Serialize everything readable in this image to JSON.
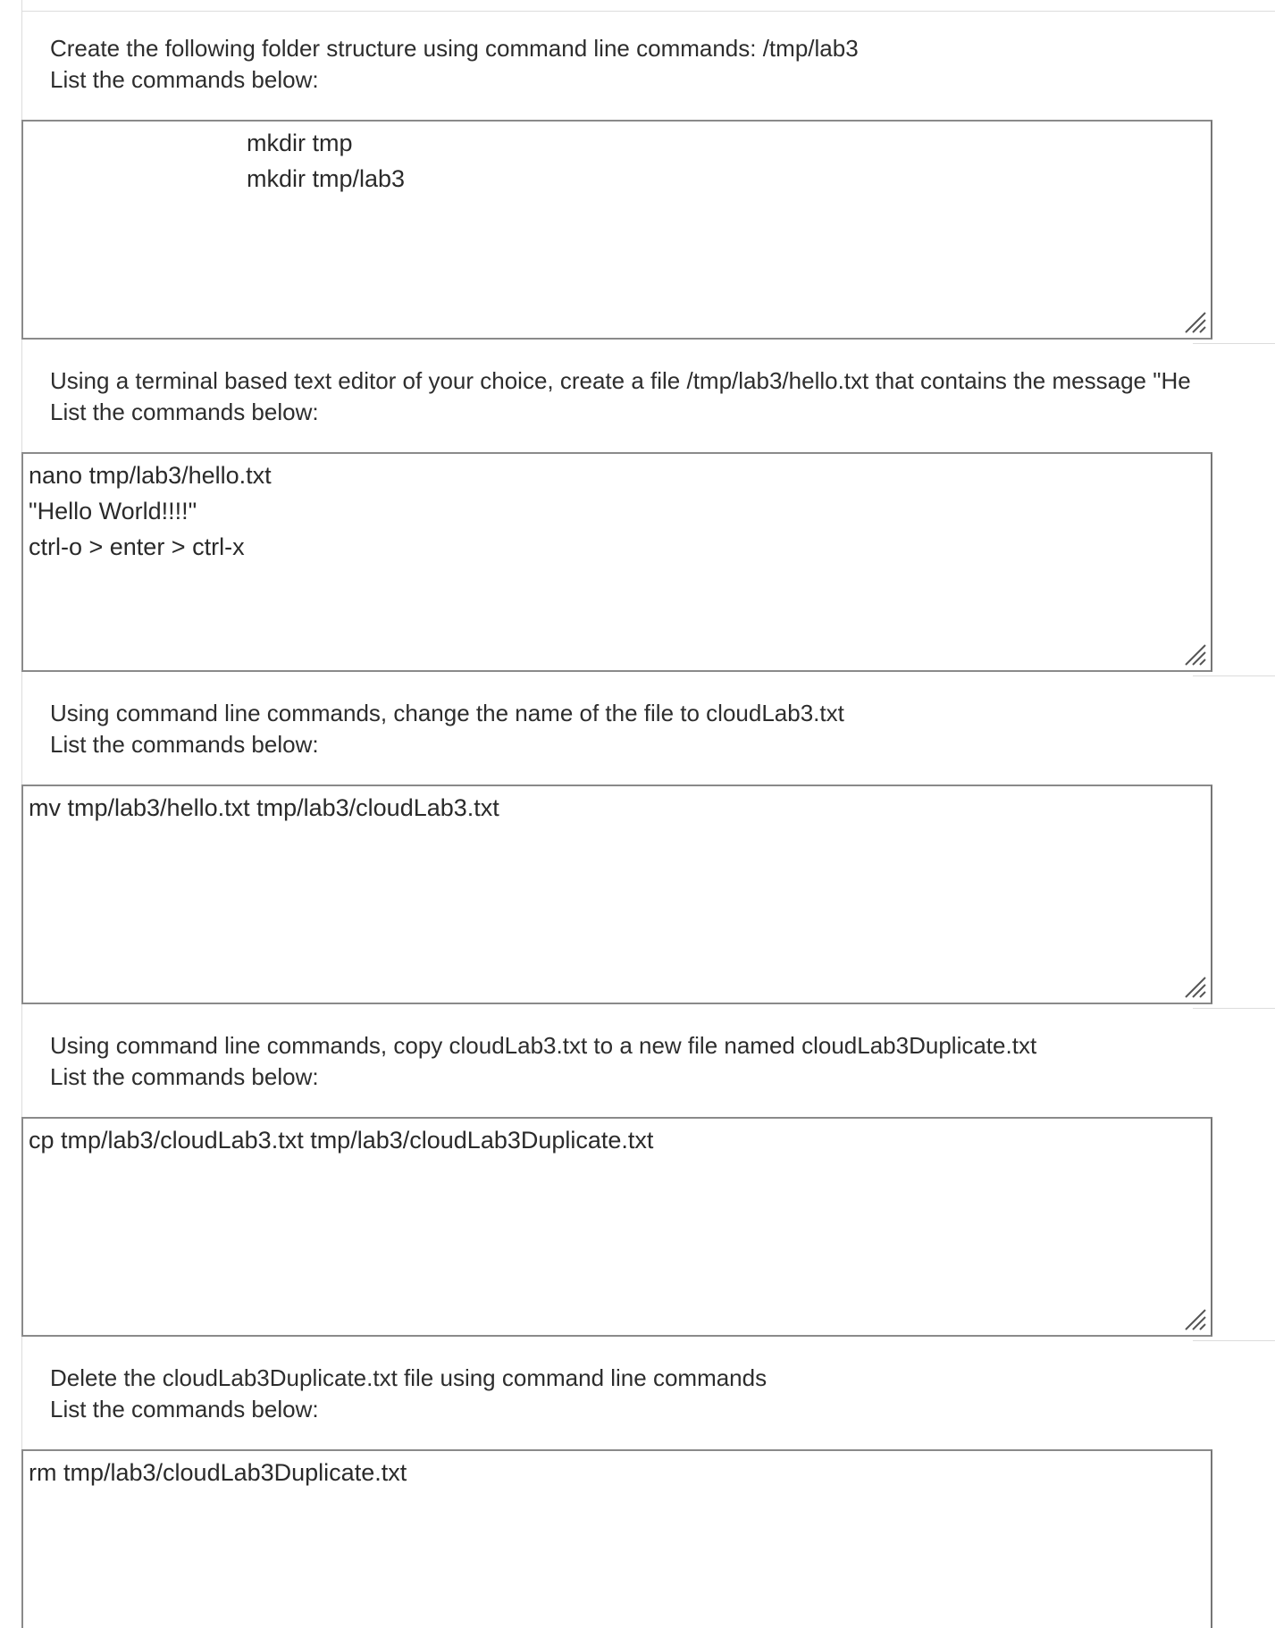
{
  "questions": [
    {
      "prompt_line1": "Create the following folder structure using command line commands: /tmp/lab3",
      "prompt_line2": "List the commands below:",
      "answer_lines": [
        "mkdir tmp",
        "mkdir tmp/lab3"
      ]
    },
    {
      "prompt_line1": "Using a terminal based text editor of your choice, create a file /tmp/lab3/hello.txt that contains the message \"He",
      "prompt_line2": "List the commands below:",
      "answer_lines": [
        "nano tmp/lab3/hello.txt",
        "\"Hello World!!!!\"",
        "ctrl-o > enter > ctrl-x"
      ]
    },
    {
      "prompt_line1": "Using command line commands, change the name of the file to cloudLab3.txt",
      "prompt_line2": "List the commands below:",
      "answer_lines": [
        "mv tmp/lab3/hello.txt tmp/lab3/cloudLab3.txt"
      ]
    },
    {
      "prompt_line1": "Using command line commands, copy cloudLab3.txt to a new file named cloudLab3Duplicate.txt",
      "prompt_line2": "List the commands below:",
      "answer_lines": [
        "cp tmp/lab3/cloudLab3.txt tmp/lab3/cloudLab3Duplicate.txt"
      ]
    },
    {
      "prompt_line1": "Delete the cloudLab3Duplicate.txt file using command line commands",
      "prompt_line2": "List the commands below:",
      "answer_lines": [
        "rm tmp/lab3/cloudLab3Duplicate.txt"
      ]
    }
  ]
}
